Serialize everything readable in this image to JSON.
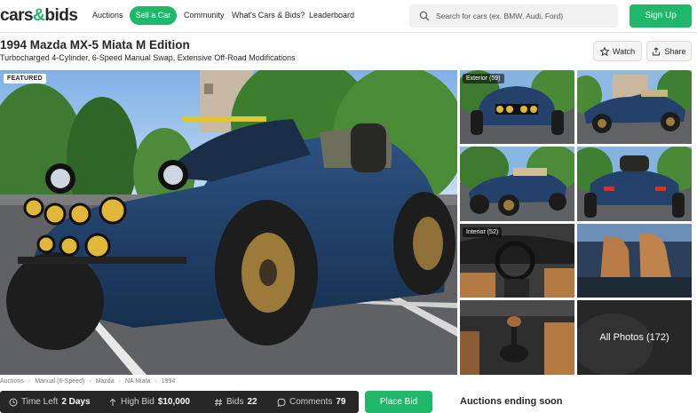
{
  "header": {
    "logo_left": "cars",
    "logo_amp": "&",
    "logo_right": "bids",
    "nav": [
      "Auctions",
      "Sell a Car",
      "Community",
      "What's Cars & Bids?",
      "Leaderboard"
    ],
    "search_placeholder": "Search for cars (ex. BMW, Audi, Ford)",
    "signup_label": "Sign Up"
  },
  "listing": {
    "title": "1994 Mazda MX-5 Miata M Edition",
    "subtitle": "Turbocharged 4-Cylinder, 6-Speed Manual Swap, Extensive Off-Road Modifications",
    "watch_label": "Watch",
    "share_label": "Share"
  },
  "gallery": {
    "featured_badge": "FEATURED",
    "exterior_label": "Exterior (59)",
    "interior_label": "Interior (52)",
    "all_photos_label": "All Photos (172)"
  },
  "breadcrumbs": [
    "Auctions",
    "Manual (6-Speed)",
    "Mazda",
    "NA Miata",
    "1994"
  ],
  "bid_bar": {
    "time_left_label": "Time Left",
    "time_left_value": "2 Days",
    "high_bid_label": "High Bid",
    "high_bid_value": "$10,000",
    "bids_label": "Bids",
    "bids_value": "22",
    "comments_label": "Comments",
    "comments_value": "79",
    "place_bid_label": "Place Bid"
  },
  "sidebar": {
    "ending_soon_heading": "Auctions ending soon"
  },
  "colors": {
    "brand_green": "#1fb86a",
    "dark_bar": "#262626",
    "car_blue": "#23416b"
  }
}
